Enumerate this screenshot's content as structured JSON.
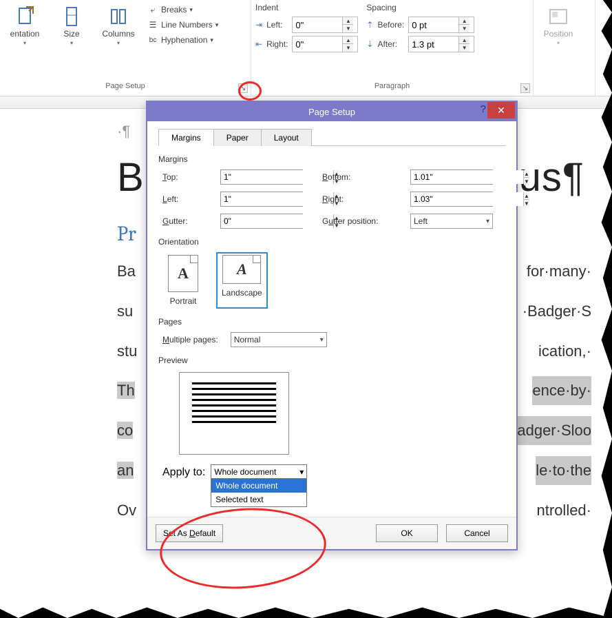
{
  "ribbon": {
    "pageSetup": {
      "label": "Page Setup",
      "orientation": "entation",
      "size": "Size",
      "columns": "Columns",
      "breaks": "Breaks",
      "lineNumbers": "Line Numbers",
      "hyphenation": "Hyphenation"
    },
    "paragraph": {
      "label": "Paragraph",
      "indentHead": "Indent",
      "spacingHead": "Spacing",
      "leftLabel": "Left:",
      "rightLabel": "Right:",
      "beforeLabel": "Before:",
      "afterLabel": "After:",
      "leftVal": "0\"",
      "rightVal": "0\"",
      "beforeVal": "0 pt",
      "afterVal": "1.3 pt"
    },
    "arrange": {
      "position": "Position"
    }
  },
  "doc": {
    "h1": "B",
    "h1tail": "ous¶",
    "h2": "Pr",
    "lines": [
      [
        "Ba",
        "for·many·"
      ],
      [
        "su",
        "·Badger·S"
      ],
      [
        "stu",
        "ication,·"
      ],
      [
        "Th",
        "ence·by·"
      ],
      [
        "co",
        "adger·Sloo"
      ],
      [
        "an",
        "le·to·the"
      ],
      [
        "Ov",
        "ntrolled·"
      ]
    ]
  },
  "dialog": {
    "title": "Page Setup",
    "tabs": {
      "margins": "Margins",
      "paper": "Paper",
      "layout": "Layout"
    },
    "margins": {
      "section": "Margins",
      "top": "Top:",
      "topVal": "1\"",
      "bottom": "Bottom:",
      "bottomVal": "1.01\"",
      "left": "Left:",
      "leftVal": "1\"",
      "right": "Right:",
      "rightVal": "1.03\"",
      "gutter": "Gutter:",
      "gutterVal": "0\"",
      "gutterPos": "Gutter position:",
      "gutterPosVal": "Left"
    },
    "orientation": {
      "section": "Orientation",
      "portrait": "Portrait",
      "landscape": "Landscape"
    },
    "pages": {
      "section": "Pages",
      "multiple": "Multiple pages:",
      "multipleVal": "Normal"
    },
    "preview": {
      "section": "Preview"
    },
    "apply": {
      "label": "Apply to:",
      "value": "Whole document",
      "opt1": "Whole document",
      "opt2": "Selected text"
    },
    "buttons": {
      "setDefault": "Set As Default",
      "ok": "OK",
      "cancel": "Cancel"
    }
  }
}
